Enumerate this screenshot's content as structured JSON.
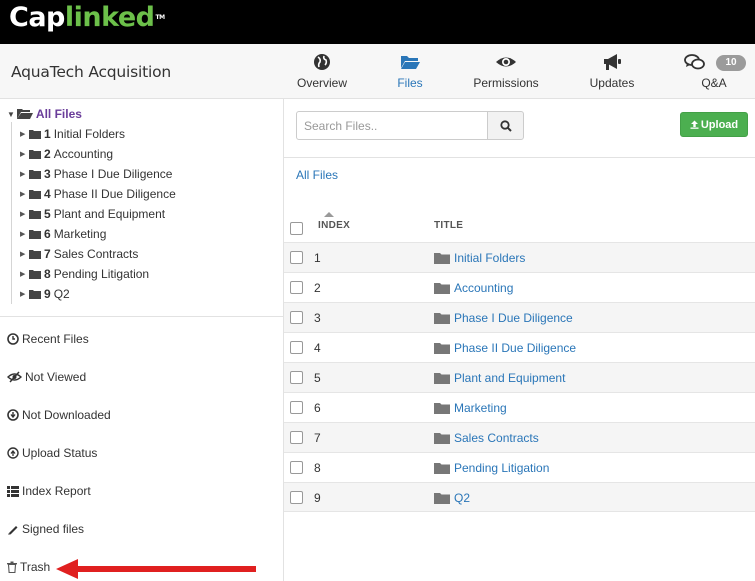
{
  "brand": {
    "logo_part1": "Cap",
    "logo_part2": "linked",
    "trademark": "TM"
  },
  "header": {
    "deal_title": "AquaTech Acquisition"
  },
  "nav": [
    {
      "label": "Overview",
      "icon": "globe-icon",
      "active": false
    },
    {
      "label": "Files",
      "icon": "folder-open-icon",
      "active": true
    },
    {
      "label": "Permissions",
      "icon": "eye-icon",
      "active": false
    },
    {
      "label": "Updates",
      "icon": "megaphone-icon",
      "active": false
    },
    {
      "label": "Q&A",
      "icon": "chat-icon",
      "active": false,
      "badge": "10"
    }
  ],
  "sidebar": {
    "root_label": "All Files",
    "folders": [
      {
        "num": "1",
        "name": "Initial Folders"
      },
      {
        "num": "2",
        "name": "Accounting"
      },
      {
        "num": "3",
        "name": "Phase I Due Diligence"
      },
      {
        "num": "4",
        "name": "Phase II Due Diligence"
      },
      {
        "num": "5",
        "name": "Plant and Equipment"
      },
      {
        "num": "6",
        "name": "Marketing"
      },
      {
        "num": "7",
        "name": "Sales Contracts"
      },
      {
        "num": "8",
        "name": "Pending Litigation"
      },
      {
        "num": "9",
        "name": "Q2"
      }
    ],
    "links": [
      {
        "label": "Recent Files",
        "icon": "clock-icon"
      },
      {
        "label": "Not Viewed",
        "icon": "eye-slash-icon"
      },
      {
        "label": "Not Downloaded",
        "icon": "download-circle-icon"
      },
      {
        "label": "Upload Status",
        "icon": "upload-circle-icon"
      },
      {
        "label": "Index Report",
        "icon": "list-icon"
      },
      {
        "label": "Signed files",
        "icon": "pen-icon"
      },
      {
        "label": "Trash",
        "icon": "trash-icon"
      }
    ]
  },
  "main": {
    "search_placeholder": "Search Files..",
    "upload_label": "Upload",
    "breadcrumb": "All Files",
    "columns": {
      "index": "INDEX",
      "title": "TITLE"
    },
    "rows": [
      {
        "index": "1",
        "title": "Initial Folders"
      },
      {
        "index": "2",
        "title": "Accounting"
      },
      {
        "index": "3",
        "title": "Phase I Due Diligence"
      },
      {
        "index": "4",
        "title": "Phase II Due Diligence"
      },
      {
        "index": "5",
        "title": "Plant and Equipment"
      },
      {
        "index": "6",
        "title": "Marketing"
      },
      {
        "index": "7",
        "title": "Sales Contracts"
      },
      {
        "index": "8",
        "title": "Pending Litigation"
      },
      {
        "index": "9",
        "title": "Q2"
      }
    ]
  },
  "annotation": {
    "arrow_color": "#e02020",
    "points_to": "Trash"
  },
  "colors": {
    "accent": "#2a76b8",
    "brand_green": "#6cc04a",
    "upload_green": "#4caf50",
    "root_purple": "#6a3d9a"
  }
}
